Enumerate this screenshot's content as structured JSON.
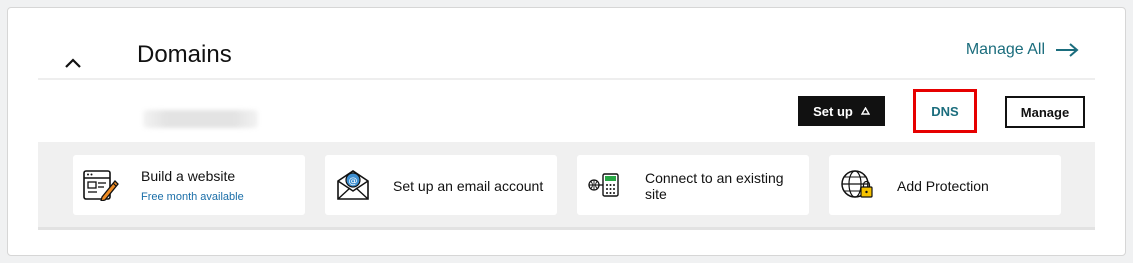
{
  "header": {
    "title": "Domains",
    "manage_all": "Manage All"
  },
  "domain_row": {
    "setup_label": "Set up",
    "dns_label": "DNS",
    "manage_label": "Manage"
  },
  "actions": [
    {
      "label": "Build a website",
      "sublabel": "Free month available",
      "icon": "website-builder-icon"
    },
    {
      "label": "Set up an email account",
      "icon": "email-icon"
    },
    {
      "label": "Connect to an existing site",
      "icon": "connect-site-icon"
    },
    {
      "label": "Add Protection",
      "icon": "globe-lock-icon"
    }
  ],
  "colors": {
    "link": "#1b6d7d",
    "highlight": "#e60000",
    "sublink": "#1a6ea8"
  }
}
